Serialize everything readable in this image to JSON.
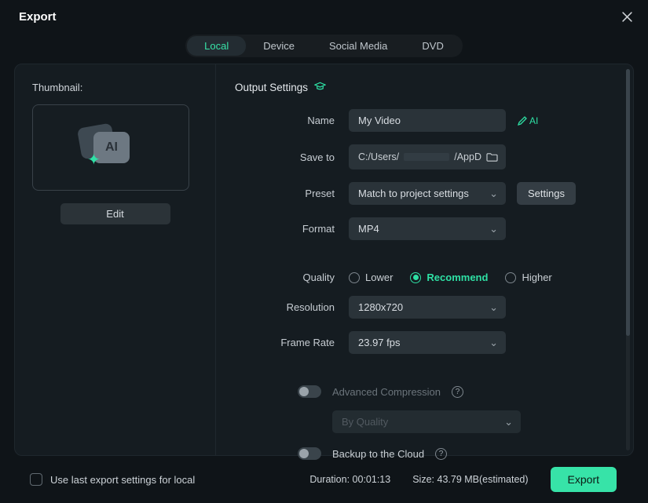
{
  "title": "Export",
  "tabs": [
    "Local",
    "Device",
    "Social Media",
    "DVD"
  ],
  "active_tab": 0,
  "left": {
    "thumbnail_label": "Thumbnail:",
    "thumb_badge": "AI",
    "edit_label": "Edit"
  },
  "output": {
    "section_title": "Output Settings",
    "name_label": "Name",
    "name_value": "My Video",
    "ai_badge": "AI",
    "saveto_label": "Save to",
    "saveto_prefix": "C:/Users/",
    "saveto_suffix": "/AppD",
    "preset_label": "Preset",
    "preset_value": "Match to project settings",
    "settings_label": "Settings",
    "format_label": "Format",
    "format_value": "MP4",
    "quality_label": "Quality",
    "quality_options": [
      "Lower",
      "Recommend",
      "Higher"
    ],
    "quality_selected": 1,
    "resolution_label": "Resolution",
    "resolution_value": "1280x720",
    "framerate_label": "Frame Rate",
    "framerate_value": "23.97 fps",
    "adv_compress_label": "Advanced Compression",
    "adv_compress_enabled": false,
    "compress_mode_value": "By Quality",
    "backup_label": "Backup to the Cloud",
    "backup_enabled": false
  },
  "footer": {
    "remember_label": "Use last export settings for local",
    "remember_checked": false,
    "duration_label": "Duration:",
    "duration_value": "00:01:13",
    "size_label": "Size:",
    "size_value": "43.79 MB(estimated)",
    "export_label": "Export"
  }
}
